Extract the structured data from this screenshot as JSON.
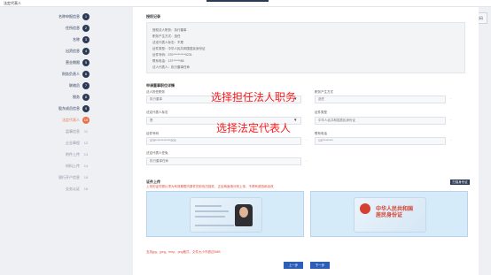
{
  "window": {
    "title": "法定代表人"
  },
  "corner_widget": {
    "label": "二维码"
  },
  "sidebar": {
    "steps": [
      {
        "label": "名称申报信息",
        "num": "1",
        "state": "done"
      },
      {
        "label": "住所信息",
        "num": "2",
        "state": "done"
      },
      {
        "label": "名称",
        "num": "3",
        "state": "done"
      },
      {
        "label": "出资信息",
        "num": "4",
        "state": "done"
      },
      {
        "label": "营业期限",
        "num": "5",
        "state": "done"
      },
      {
        "label": "财务负责人",
        "num": "6",
        "state": "done"
      },
      {
        "label": "联络员",
        "num": "7",
        "state": "done"
      },
      {
        "label": "税务",
        "num": "8",
        "state": "done"
      },
      {
        "label": "股东成员信息",
        "num": "9",
        "state": "done"
      },
      {
        "label": "法定代表人",
        "num": "10",
        "state": "active"
      },
      {
        "label": "监事信息",
        "num": "11",
        "state": "todo"
      },
      {
        "label": "企业章程",
        "num": "12",
        "state": "todo"
      },
      {
        "label": "附件上传",
        "num": "13",
        "state": "todo"
      },
      {
        "label": "材料上传",
        "num": "14",
        "state": "todo"
      },
      {
        "label": "银行开户信息",
        "num": "15",
        "state": "todo"
      },
      {
        "label": "业务认证",
        "num": "16",
        "state": "todo"
      }
    ]
  },
  "main": {
    "record_title": "授权记录",
    "record_rows": [
      "授权法人职务：执行董事",
      "职务产生方式：选任",
      "法定代表人标志：不是",
      "证件类型：中华人民共和国居民身份证",
      "证件号码：370**********0231",
      "联系电话：137******88",
      "法人代表人：执行董事任命"
    ],
    "section2_title": "申请董事职位详情",
    "field_position_label": "法人担任职务",
    "field_position_value": "执行董事",
    "field_origin_label": "职务产生方式",
    "field_origin_value": "选任",
    "field_is_legal_label": "法定代表人标志",
    "field_is_legal_value": "是",
    "field_id_type_label": "证件类型",
    "field_id_type_value": "中华人民共和国居民身份证",
    "field_id_no_label": "证件号码",
    "field_id_no_value": "370*************203",
    "field_phone_label": "联系电话",
    "field_phone_value": "137********",
    "field_person_label": "法定代表人任免",
    "field_person_value": "执行董事任命",
    "overlay_1": "选择担任法人职务",
    "overlay_2": "选择法定代表人",
    "upload_title": "证件上传",
    "upload_note": "上传的证件照片须为有效期限内原件的彩色扫描件，正反两面请分别上传，不得有遮挡和涂改",
    "scan_button": "扫描身份证",
    "idcard_front_title": "中华人民共和国",
    "idcard_front_sub": "居民身份证",
    "footnote": "支持jpg、jpeg、bmp、png格式，文件大小不超过5MB",
    "prev_button": "上一步",
    "next_button": "下一步"
  }
}
